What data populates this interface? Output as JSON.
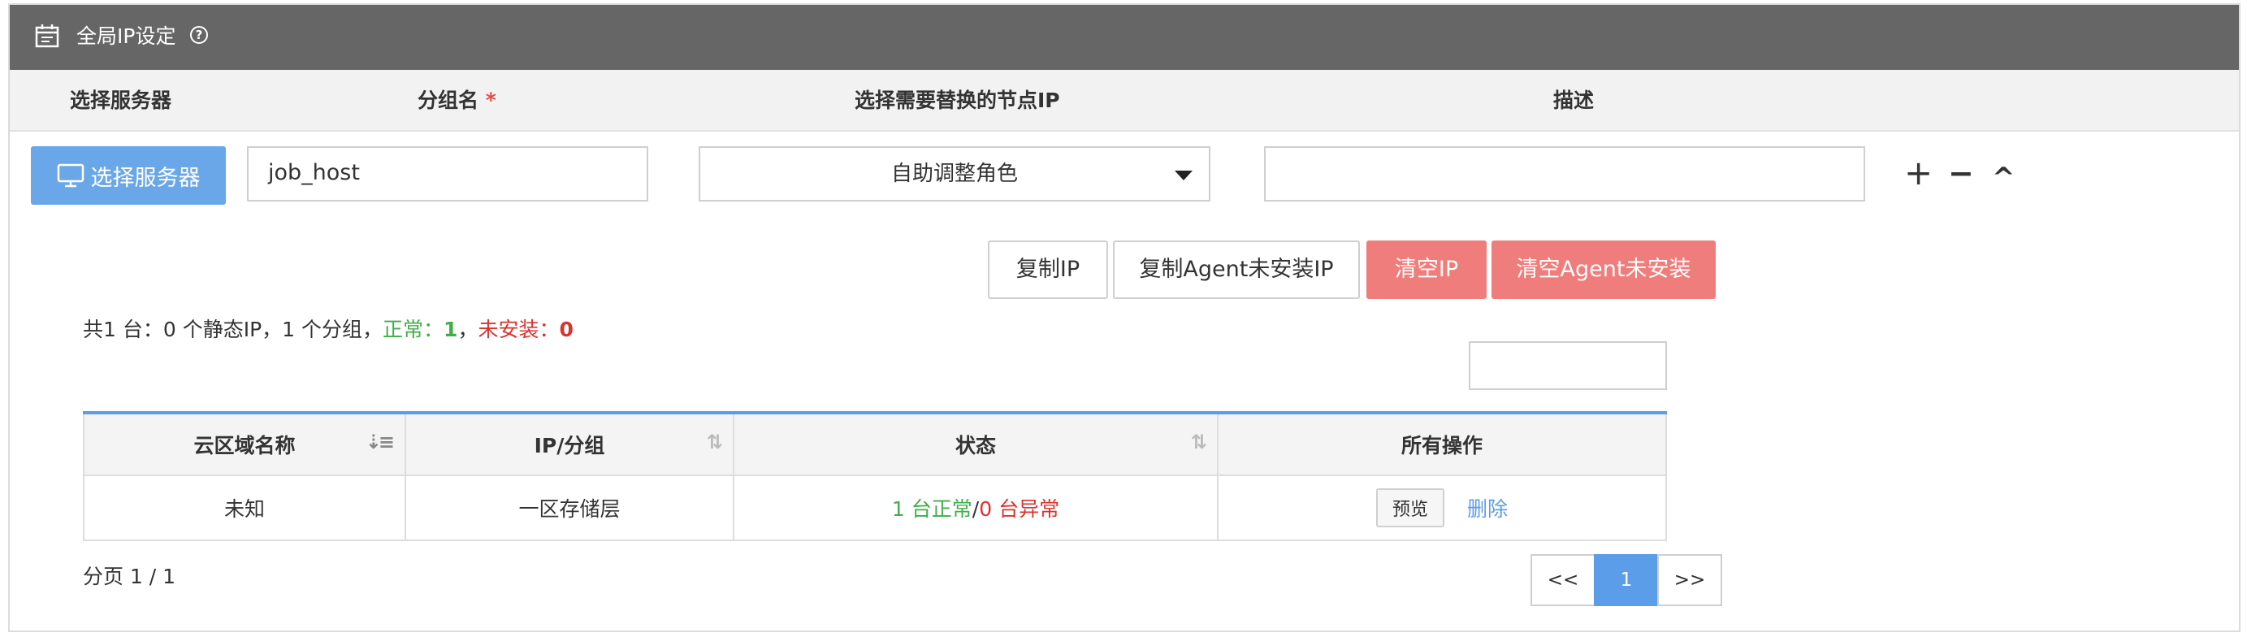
{
  "header": {
    "title": "全局IP设定",
    "help_icon": "question-circle-icon",
    "calendar_icon": "calendar-icon"
  },
  "columns": {
    "select_server": "选择服务器",
    "group_name": "分组名",
    "required_mark": "*",
    "node_ip": "选择需要替换的节点IP",
    "description": "描述"
  },
  "row": {
    "select_button": "选择服务器",
    "group_value": "job_host",
    "node_select_value": "自助调整角色",
    "description_value": "",
    "add": "+",
    "remove": "−",
    "collapse": "^"
  },
  "actions": {
    "copy_ip": "复制IP",
    "copy_agent": "复制Agent未安装IP",
    "clear_ip": "清空IP",
    "clear_agent": "清空Agent未安装"
  },
  "summary": {
    "prefix": "共1 台：0 个静态IP，1 个分组，",
    "normal_label": "正常：",
    "normal_count": "1",
    "separator": "，",
    "uninstalled_label": "未安装：",
    "uninstalled_count": "0"
  },
  "filter_value": "",
  "table": {
    "headers": [
      "云区域名称",
      "IP/分组",
      "状态",
      "所有操作"
    ],
    "rows": [
      {
        "region": "未知",
        "ip_group": "一区存储层",
        "status_ok": "1 台正常",
        "status_sep": "/",
        "status_bad": "0 台异常",
        "preview": "预览",
        "delete": "删除"
      }
    ]
  },
  "pager": {
    "text": "分页 1 / 1",
    "prev": "<<",
    "current": "1",
    "next": ">>"
  },
  "colors": {
    "header_bg": "#666666",
    "primary": "#5b9de8",
    "danger": "#ef7d7b",
    "success": "#3fae49",
    "error": "#d9332f"
  }
}
